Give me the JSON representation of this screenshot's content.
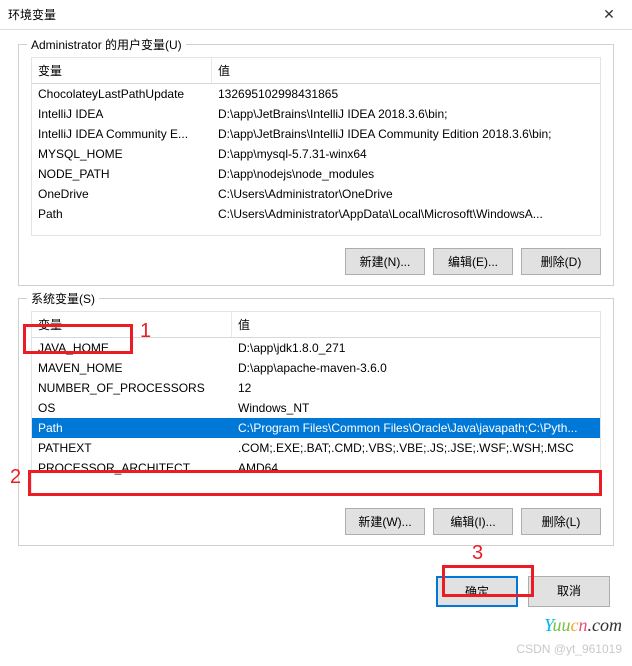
{
  "window": {
    "title": "环境变量"
  },
  "userVars": {
    "legend": "Administrator 的用户变量(U)",
    "headers": {
      "var": "变量",
      "val": "值"
    },
    "rows": [
      {
        "var": "ChocolateyLastPathUpdate",
        "val": "132695102998431865"
      },
      {
        "var": "IntelliJ IDEA",
        "val": "D:\\app\\JetBrains\\IntelliJ IDEA 2018.3.6\\bin;"
      },
      {
        "var": "IntelliJ IDEA Community E...",
        "val": "D:\\app\\JetBrains\\IntelliJ IDEA Community Edition 2018.3.6\\bin;"
      },
      {
        "var": "MYSQL_HOME",
        "val": "D:\\app\\mysql-5.7.31-winx64"
      },
      {
        "var": "NODE_PATH",
        "val": "D:\\app\\nodejs\\node_modules"
      },
      {
        "var": "OneDrive",
        "val": "C:\\Users\\Administrator\\OneDrive"
      },
      {
        "var": "Path",
        "val": "C:\\Users\\Administrator\\AppData\\Local\\Microsoft\\WindowsA..."
      }
    ],
    "buttons": {
      "new": "新建(N)...",
      "edit": "编辑(E)...",
      "del": "删除(D)"
    }
  },
  "sysVars": {
    "legend": "系统变量(S)",
    "headers": {
      "var": "变量",
      "val": "值"
    },
    "rows": [
      {
        "var": "JAVA_HOME",
        "val": "D:\\app\\jdk1.8.0_271"
      },
      {
        "var": "MAVEN_HOME",
        "val": "D:\\app\\apache-maven-3.6.0"
      },
      {
        "var": "NUMBER_OF_PROCESSORS",
        "val": "12"
      },
      {
        "var": "OS",
        "val": "Windows_NT"
      },
      {
        "var": "Path",
        "val": "C:\\Program Files\\Common Files\\Oracle\\Java\\javapath;C:\\Pyth..."
      },
      {
        "var": "PATHEXT",
        "val": ".COM;.EXE;.BAT;.CMD;.VBS;.VBE;.JS;.JSE;.WSF;.WSH;.MSC"
      },
      {
        "var": "PROCESSOR_ARCHITECT...",
        "val": "AMD64"
      }
    ],
    "selectedIndex": 4,
    "buttons": {
      "new": "新建(W)...",
      "edit": "编辑(I)...",
      "del": "删除(L)"
    }
  },
  "footer": {
    "ok": "确定",
    "cancel": "取消"
  },
  "annotations": {
    "label1": "1",
    "label2": "2",
    "label3": "3"
  },
  "watermark": "Yuucn.com",
  "credit": "CSDN @yt_961019"
}
